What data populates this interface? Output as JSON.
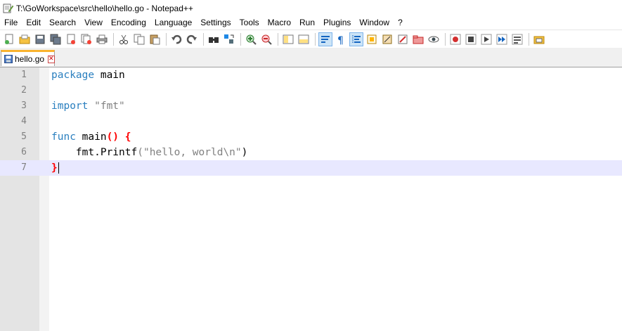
{
  "window": {
    "title": "T:\\GoWorkspace\\src\\hello\\hello.go - Notepad++"
  },
  "menu": [
    "File",
    "Edit",
    "Search",
    "View",
    "Encoding",
    "Language",
    "Settings",
    "Tools",
    "Macro",
    "Run",
    "Plugins",
    "Window",
    "?"
  ],
  "toolbar": {
    "icons": [
      "new-file-icon",
      "open-file-icon",
      "save-icon",
      "save-all-icon",
      "close-icon",
      "close-all-icon",
      "print-icon",
      "cut-icon",
      "copy-icon",
      "paste-icon",
      "undo-icon",
      "redo-icon",
      "find-icon",
      "replace-icon",
      "zoom-in-icon",
      "zoom-out-icon",
      "sync-vertical-icon",
      "sync-horizontal-icon",
      "word-wrap-icon",
      "show-all-chars-icon",
      "indent-guide-icon",
      "document-map-icon",
      "function-list-icon",
      "folder-as-workspace-icon",
      "monitoring-icon",
      "record-macro-icon",
      "stop-record-icon",
      "play-macro-icon",
      "run-macro-multiple-icon",
      "save-macro-icon",
      "launch-in-browser-icon"
    ]
  },
  "tab": {
    "label": "hello.go",
    "close_symbol": "✕"
  },
  "editor": {
    "current_line": 7,
    "lines": [
      {
        "num": "1",
        "keyword": "package",
        "rest": " main"
      },
      {
        "num": "2"
      },
      {
        "num": "3",
        "keyword": "import",
        "string": " \"fmt\""
      },
      {
        "num": "4"
      },
      {
        "num": "5",
        "keyword": "func",
        "rest": " main",
        "paren": "()",
        "brace": "{"
      },
      {
        "num": "6",
        "indent": "    ",
        "call": "fmt.Printf",
        "str_open": "(",
        "string": "\"hello, world\\n\"",
        "str_close": ")"
      },
      {
        "num": "7",
        "brace": "}"
      }
    ]
  },
  "colors": {
    "keyword": "#2a7fbf",
    "string": "#808080",
    "brace": "#ff0000",
    "current_line": "#e8e8ff",
    "gutter": "#e4e4e4",
    "tab_accent": "#fab32e"
  }
}
